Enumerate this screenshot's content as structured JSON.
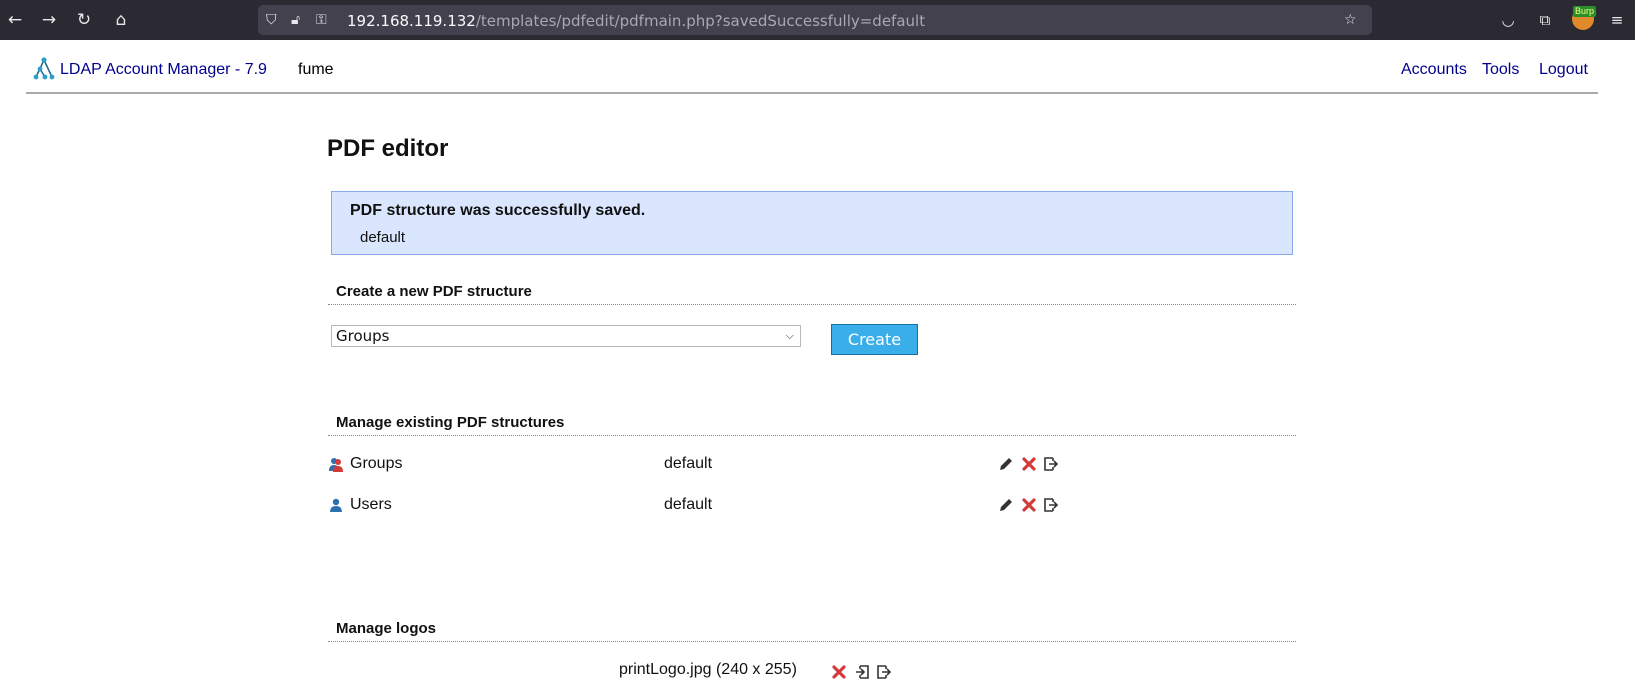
{
  "browser": {
    "url_host": "192.168.119.132",
    "url_path": "/templates/pdfedit/pdfmain.php?savedSuccessfully=default",
    "burp_badge": "Burp"
  },
  "header": {
    "app_title": "LDAP Account Manager - 7.9",
    "server": "fume",
    "nav": [
      "Accounts",
      "Tools",
      "Logout"
    ]
  },
  "main": {
    "title": "PDF editor",
    "message": {
      "title": "PDF structure was successfully saved.",
      "detail": "default"
    },
    "create_section": {
      "heading": "Create a new PDF structure",
      "selected_type": "Groups",
      "create_label": "Create"
    },
    "manage_section": {
      "heading": "Manage existing PDF structures",
      "rows": [
        {
          "type": "Groups",
          "name": "default",
          "icon": "group-icon"
        },
        {
          "type": "Users",
          "name": "default",
          "icon": "user-icon"
        }
      ]
    },
    "logos_section": {
      "heading": "Manage logos",
      "logo": "printLogo.jpg (240 x 255)"
    }
  }
}
